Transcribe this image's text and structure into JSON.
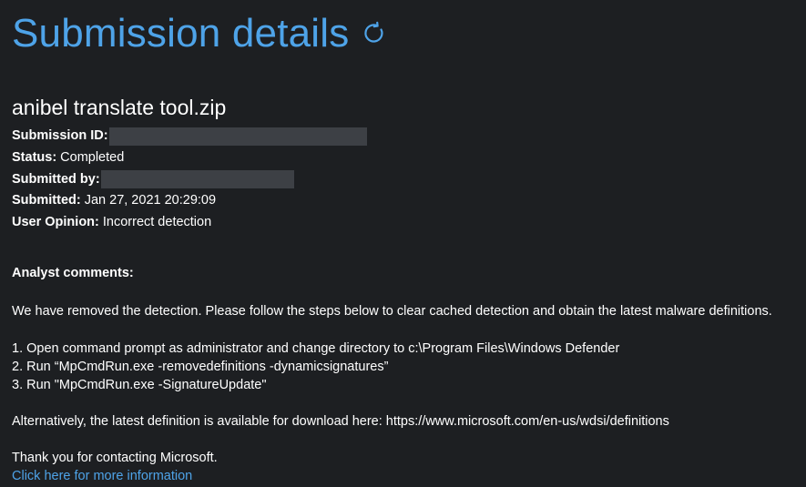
{
  "header": {
    "title": "Submission details",
    "refresh_icon": "refresh-icon"
  },
  "submission": {
    "file_name": "anibel translate tool.zip",
    "fields": {
      "submission_id_label": "Submission ID:",
      "status_label": "Status:",
      "status_value": "Completed",
      "submitted_by_label": "Submitted by:",
      "submitted_label": "Submitted:",
      "submitted_value": "Jan 27, 2021 20:29:09",
      "user_opinion_label": "User Opinion:",
      "user_opinion_value": "Incorrect detection"
    }
  },
  "analyst": {
    "heading": "Analyst comments:",
    "intro": "We have removed the detection. Please follow the steps below to clear cached detection and obtain the latest malware definitions.",
    "steps": [
      "1. Open command prompt as administrator and change directory to c:\\Program Files\\Windows Defender",
      "2. Run “MpCmdRun.exe -removedefinitions -dynamicsignatures”",
      "3. Run \"MpCmdRun.exe -SignatureUpdate\""
    ],
    "alternative": "Alternatively, the latest definition is available for download here: https://www.microsoft.com/en-us/wdsi/definitions",
    "thanks": "Thank you for contacting Microsoft.",
    "more_info_link": "Click here for more information"
  },
  "colors": {
    "background": "#1d1f22",
    "accent": "#4ea3e8",
    "text": "#ffffff",
    "redaction": "#3d4045"
  }
}
